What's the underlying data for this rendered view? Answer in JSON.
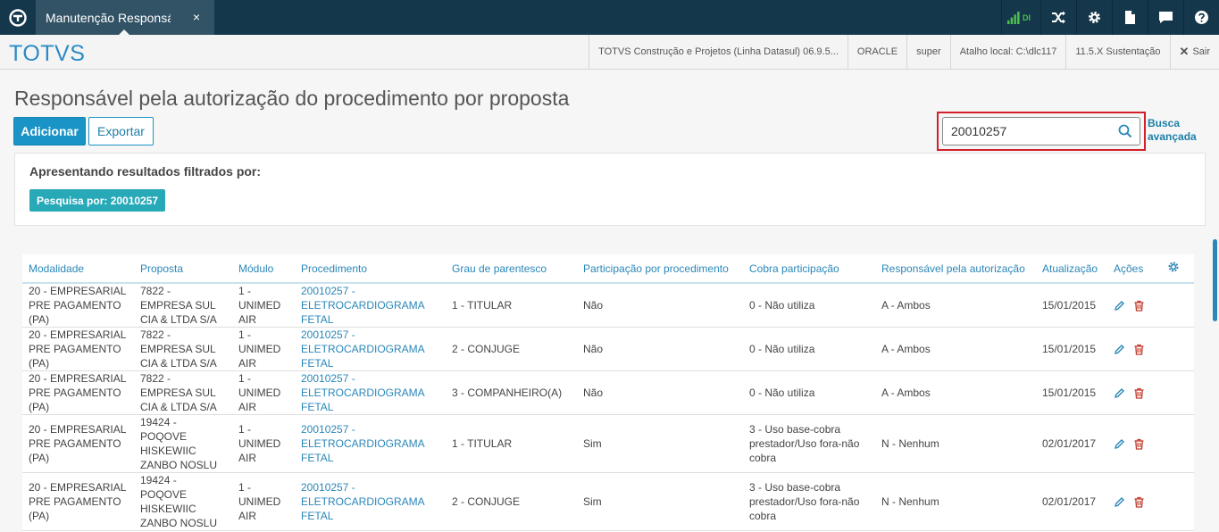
{
  "topbar": {
    "tab_label": "Manutenção Responsável",
    "tab_close": "×",
    "signal_text": "DI",
    "icons": [
      "logo-icon",
      "signal-icon",
      "shuffle-icon",
      "gear-icon",
      "document-icon",
      "chat-icon",
      "help-icon"
    ]
  },
  "header": {
    "brand": "TOTVS",
    "product": "TOTVS Construção e Projetos (Linha Datasul) 06.9.5...",
    "database": "ORACLE",
    "user": "super",
    "shortcut": "Atalho local: C:\\dlc117",
    "version": "11.5.X Sustentação",
    "logout": "Sair"
  },
  "page": {
    "title": "Responsável pela autorização do procedimento por proposta",
    "add_label": "Adicionar",
    "export_label": "Exportar",
    "search_value": "20010257",
    "advanced_search": "Busca avançada"
  },
  "filter": {
    "title": "Apresentando resultados filtrados por:",
    "chip": "Pesquisa por: 20010257"
  },
  "table": {
    "columns": [
      "Modalidade",
      "Proposta",
      "Módulo",
      "Procedimento",
      "Grau de parentesco",
      "Participação por procedimento",
      "Cobra participação",
      "Responsável pela autorização",
      "Atualização",
      "Ações"
    ],
    "rows": [
      {
        "modalidade": "20 - EMPRESARIAL PRE PAGAMENTO (PA)",
        "proposta": "7822 - EMPRESA SUL CIA & LTDA S/A",
        "modulo": "1 - UNIMED AIR",
        "procedimento": "20010257 - ELETROCARDIOGRAMA FETAL",
        "grau": "1 - TITULAR",
        "participacao": "Não",
        "cobra": "0 - Não utiliza",
        "responsavel": "A - Ambos",
        "atualizacao": "15/01/2015"
      },
      {
        "modalidade": "20 - EMPRESARIAL PRE PAGAMENTO (PA)",
        "proposta": "7822 - EMPRESA SUL CIA & LTDA S/A",
        "modulo": "1 - UNIMED AIR",
        "procedimento": "20010257 - ELETROCARDIOGRAMA FETAL",
        "grau": "2 - CONJUGE",
        "participacao": "Não",
        "cobra": "0 - Não utiliza",
        "responsavel": "A - Ambos",
        "atualizacao": "15/01/2015"
      },
      {
        "modalidade": "20 - EMPRESARIAL PRE PAGAMENTO (PA)",
        "proposta": "7822 - EMPRESA SUL CIA & LTDA S/A",
        "modulo": "1 - UNIMED AIR",
        "procedimento": "20010257 - ELETROCARDIOGRAMA FETAL",
        "grau": "3 - COMPANHEIRO(A)",
        "participacao": "Não",
        "cobra": "0 - Não utiliza",
        "responsavel": "A - Ambos",
        "atualizacao": "15/01/2015"
      },
      {
        "modalidade": "20 - EMPRESARIAL PRE PAGAMENTO (PA)",
        "proposta": "19424 - POQOVE HISKEWIIC ZANBO NOSLU",
        "modulo": "1 - UNIMED AIR",
        "procedimento": "20010257 - ELETROCARDIOGRAMA FETAL",
        "grau": "1 - TITULAR",
        "participacao": "Sim",
        "cobra": "3 - Uso base-cobra prestador/Uso fora-não cobra",
        "responsavel": "N - Nenhum",
        "atualizacao": "02/01/2017"
      },
      {
        "modalidade": "20 - EMPRESARIAL PRE PAGAMENTO (PA)",
        "proposta": "19424 - POQOVE HISKEWIIC ZANBO NOSLU",
        "modulo": "1 - UNIMED AIR",
        "procedimento": "20010257 - ELETROCARDIOGRAMA FETAL",
        "grau": "2 - CONJUGE",
        "participacao": "Sim",
        "cobra": "3 - Uso base-cobra prestador/Uso fora-não cobra",
        "responsavel": "N - Nenhum",
        "atualizacao": "02/01/2017"
      }
    ]
  },
  "colors": {
    "topbar": "#15374b",
    "tab": "#325366",
    "accent": "#1a94c6",
    "link": "#2a87b8",
    "chip": "#27a9b8",
    "highlight": "#d2202a",
    "delete": "#c0392b"
  }
}
